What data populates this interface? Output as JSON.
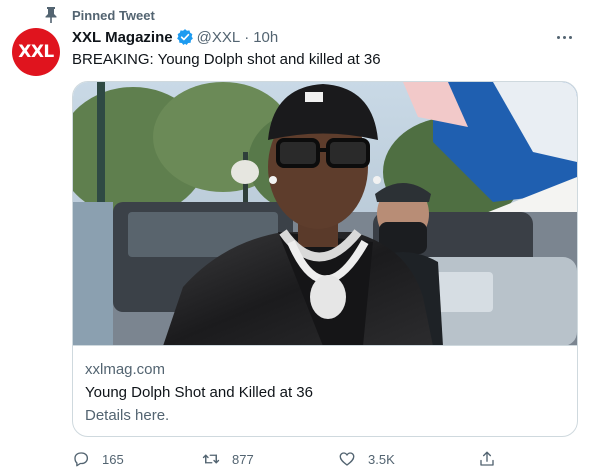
{
  "pinned": {
    "label": "Pinned Tweet",
    "icon": "pin-icon"
  },
  "author": {
    "avatar_text": "XXL",
    "avatar_color": "#e0141e",
    "name": "XXL Magazine",
    "verified_color": "#1d9bf0",
    "handle": "@XXL",
    "separator": "·",
    "time": "10h"
  },
  "tweet": {
    "text": "BREAKING: Young Dolph shot and killed at 36"
  },
  "card": {
    "domain": "xxlmag.com",
    "title": "Young Dolph Shot and Killed at 36",
    "description": "Details here."
  },
  "actions": {
    "reply": {
      "count": "165",
      "icon": "reply-icon"
    },
    "retweet": {
      "count": "877",
      "icon": "retweet-icon"
    },
    "like": {
      "count": "3.5K",
      "icon": "heart-icon"
    },
    "share": {
      "icon": "share-icon"
    }
  },
  "colors": {
    "secondary_text": "#536471",
    "border": "#cfd9de",
    "primary_text": "#0f1419"
  }
}
